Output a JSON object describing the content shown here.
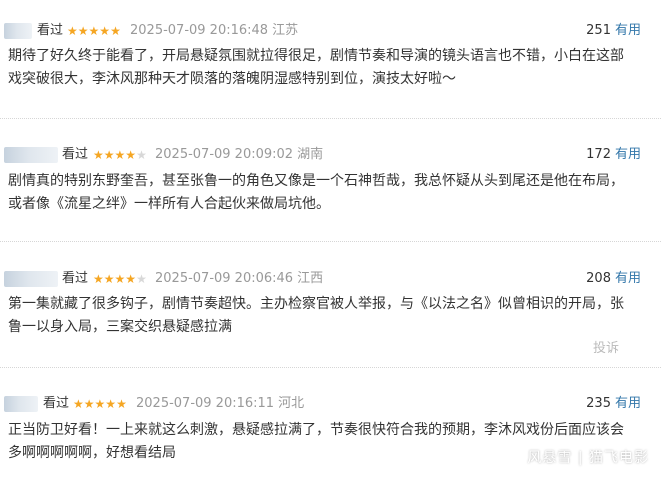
{
  "accent_color": "#3377aa",
  "star_color": "#f5a623",
  "reviews": [
    {
      "status": "看过",
      "rating": 5,
      "time": "2025-07-09 20:16:48",
      "location": "江苏",
      "votes": "251",
      "useful_label": "有用",
      "content": "期待了好久终于能看了，开局悬疑氛围就拉得很足，剧情节奏和导演的镜头语言也不错，小白在这部戏突破很大，李沐风那种天才陨落的落魄阴湿感特别到位，演技太好啦～"
    },
    {
      "status": "看过",
      "rating": 4,
      "time": "2025-07-09 20:09:02",
      "location": "湖南",
      "votes": "172",
      "useful_label": "有用",
      "content": "剧情真的特别东野奎吾，甚至张鲁一的角色又像是一个石神哲哉，我总怀疑从头到尾还是他在布局，或者像《流星之绊》一样所有人合起伙来做局坑他。"
    },
    {
      "status": "看过",
      "rating": 4,
      "time": "2025-07-09 20:06:46",
      "location": "江西",
      "votes": "208",
      "useful_label": "有用",
      "content": "第一集就藏了很多钩子，剧情节奏超快。主办检察官被人举报，与《以法之名》似曾相识的开局，张鲁一以身入局，三案交织悬疑感拉满",
      "report_label": "投诉"
    },
    {
      "status": "看过",
      "rating": 5,
      "time": "2025-07-09 20:16:11",
      "location": "河北",
      "votes": "235",
      "useful_label": "有用",
      "content": "正当防卫好看！一上来就这么刺激，悬疑感拉满了，节奏很快符合我的预期，李沐风戏份后面应该会多啊啊啊啊啊，好想看结局"
    }
  ],
  "watermark": "风悬雪 | 猫飞电影"
}
